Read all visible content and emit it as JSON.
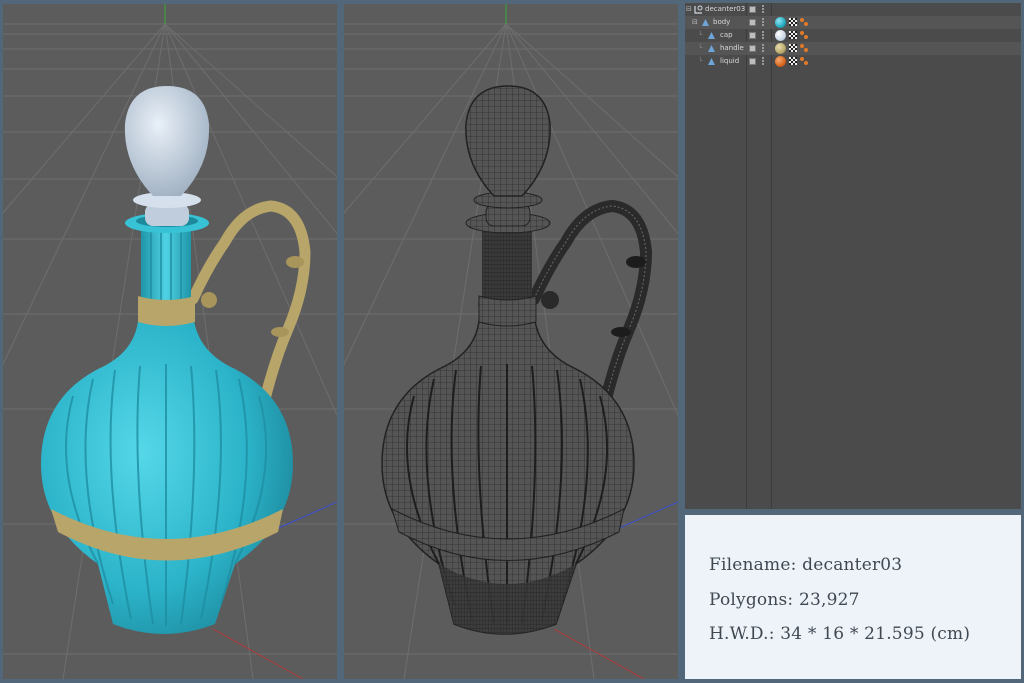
{
  "object_manager": {
    "rows": [
      {
        "name": "decanter03",
        "type": "null",
        "material_color": null
      },
      {
        "name": "body",
        "type": "polygon",
        "material_color": "#23aac0"
      },
      {
        "name": "cap",
        "type": "polygon",
        "material_color": "#c8d6e6"
      },
      {
        "name": "handle",
        "type": "polygon",
        "material_color": "#b9a96a"
      },
      {
        "name": "liquid",
        "type": "polygon",
        "material_color": "#d8661e"
      }
    ]
  },
  "info": {
    "filename": "Filename: decanter03",
    "polygons": "Polygons: 23,927",
    "dimensions": "H.W.D.: 34 * 16 * 21.595 (cm)"
  },
  "colors": {
    "frame": "#52677a",
    "viewport_bg": "#5c5c5c",
    "body": "#2bb3c9",
    "band": "#b8a56a",
    "cap": "#c9d6e4",
    "wire": "#3c3c3c"
  },
  "icons": [
    "null-object-icon",
    "polygon-object-icon",
    "visibility-icon",
    "material-icon",
    "texture-tag-icon",
    "phong-tag-icon"
  ]
}
